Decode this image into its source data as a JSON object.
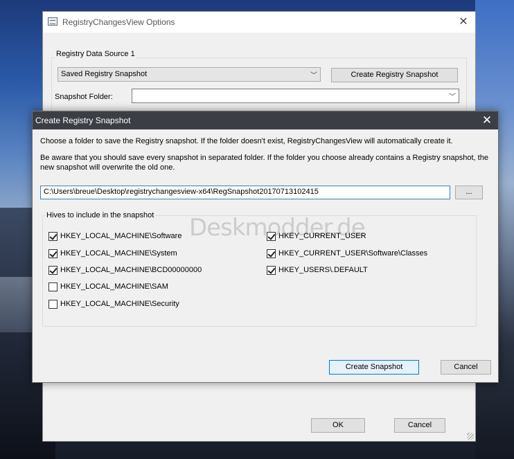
{
  "options_window": {
    "title": "RegistryChangesView Options",
    "group_label": "Registry Data Source 1",
    "source_selected": "Saved Registry Snapshot",
    "create_registry_snapshot_label": "Create Registry Snapshot",
    "snapshot_folder_label": "Snapshot Folder:",
    "snapshot_folder_value": "",
    "ok_label": "OK",
    "cancel_label": "Cancel"
  },
  "dialog": {
    "title": "Create Registry Snapshot",
    "instruction_1": "Choose a folder to save the Registry snapshot. If the folder doesn't exist, RegistryChangesView will automatically create it.",
    "instruction_2": "Be aware that you should save every snapshot in separated folder. If the folder you choose already contains a Registry snapshot, the new snapshot will overwrite the old one.",
    "path_value": "C:\\Users\\breue\\Desktop\\registrychangesview-x64\\RegSnapshot20170713102415",
    "browse_label": "...",
    "hives_group_label": "Hives to include in the snapshot",
    "hives_left": [
      {
        "label": "HKEY_LOCAL_MACHINE\\Software",
        "checked": true
      },
      {
        "label": "HKEY_LOCAL_MACHINE\\System",
        "checked": true
      },
      {
        "label": "HKEY_LOCAL_MACHINE\\BCD00000000",
        "checked": true
      },
      {
        "label": "HKEY_LOCAL_MACHINE\\SAM",
        "checked": false
      },
      {
        "label": "HKEY_LOCAL_MACHINE\\Security",
        "checked": false
      }
    ],
    "hives_right": [
      {
        "label": "HKEY_CURRENT_USER",
        "checked": true
      },
      {
        "label": "HKEY_CURRENT_USER\\Software\\Classes",
        "checked": true
      },
      {
        "label": "HKEY_USERS\\.DEFAULT",
        "checked": true
      }
    ],
    "create_snapshot_label": "Create Snapshot",
    "cancel_label": "Cancel"
  },
  "watermark": "Deskmodder.de",
  "icons": {
    "close": "close-icon",
    "dropdown": "chevron-down-icon",
    "app": "app-window-icon"
  },
  "colors": {
    "dialog_titlebar": "#3b3f45",
    "default_button_border": "#0078d7",
    "input_focus_border": "#3c7fb1"
  }
}
